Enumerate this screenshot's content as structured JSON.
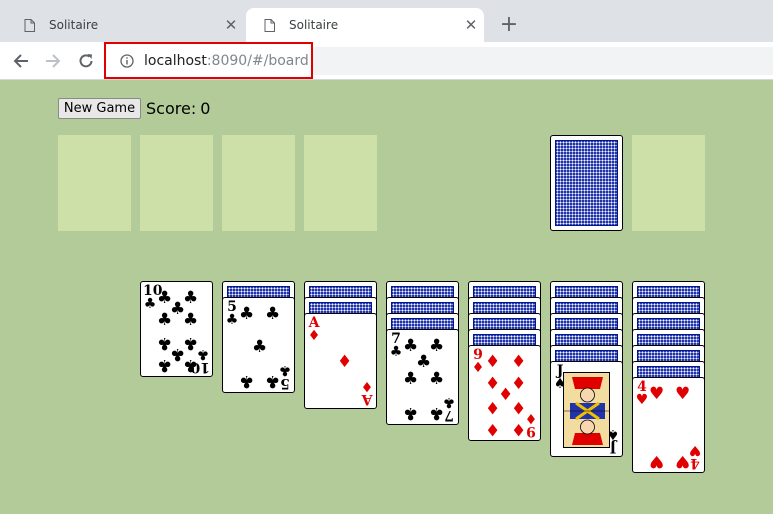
{
  "tabs": [
    {
      "title": "Solitaire",
      "active": false
    },
    {
      "title": "Solitaire",
      "active": true
    }
  ],
  "address": {
    "host": "localhost",
    "rest": ":8090/#/board"
  },
  "game": {
    "new_game_label": "New Game",
    "score_label": "Score:",
    "score_value": "0"
  },
  "foundations": [
    "empty",
    "empty",
    "empty",
    "empty"
  ],
  "stock": {
    "state": "face-down"
  },
  "waste": {
    "state": "empty"
  },
  "tableau": [
    {
      "hidden": 0,
      "face_up": [
        {
          "rank": "10",
          "suit": "clubs"
        }
      ]
    },
    {
      "hidden": 1,
      "face_up": [
        {
          "rank": "5",
          "suit": "clubs"
        }
      ]
    },
    {
      "hidden": 2,
      "face_up": [
        {
          "rank": "A",
          "suit": "diamonds"
        }
      ]
    },
    {
      "hidden": 3,
      "face_up": [
        {
          "rank": "7",
          "suit": "clubs"
        }
      ]
    },
    {
      "hidden": 4,
      "face_up": [
        {
          "rank": "9",
          "suit": "diamonds"
        }
      ]
    },
    {
      "hidden": 5,
      "face_up": [
        {
          "rank": "J",
          "suit": "spades"
        }
      ]
    },
    {
      "hidden": 6,
      "face_up": [
        {
          "rank": "4",
          "suit": "hearts"
        }
      ]
    }
  ],
  "colors": {
    "felt": "#b2cb98",
    "slot": "#cde0a8",
    "card_back": "#1a2fa6",
    "red_suit": "#e00000"
  }
}
